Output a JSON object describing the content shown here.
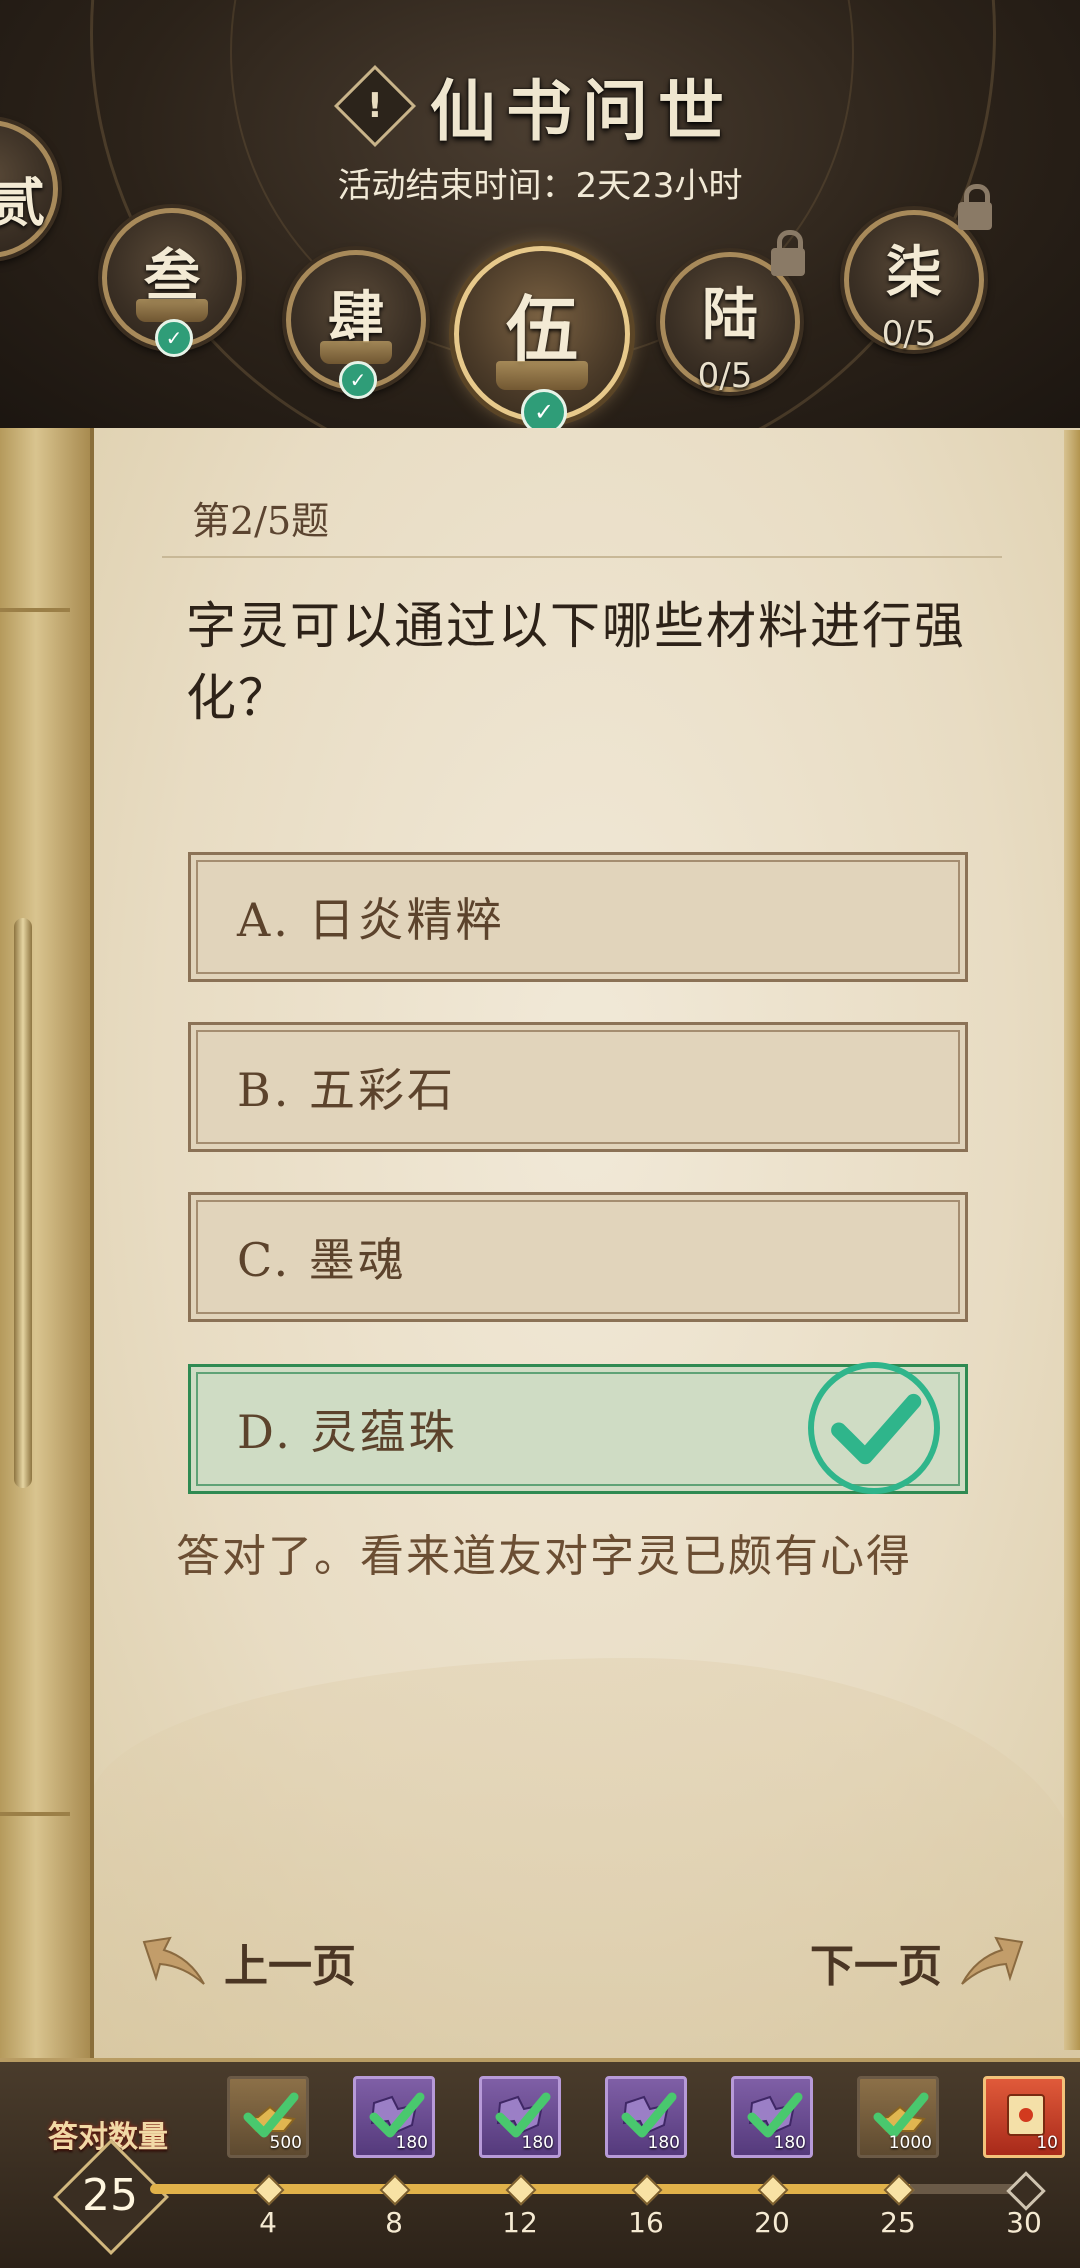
{
  "header": {
    "title": "仙书问世",
    "info_icon": "exclamation-icon",
    "subtitle": "活动结束时间：2天23小时"
  },
  "chapters": [
    {
      "label": "贰",
      "status": "completed"
    },
    {
      "label": "叁",
      "status": "completed"
    },
    {
      "label": "肆",
      "status": "completed"
    },
    {
      "label": "伍",
      "status": "active-completed"
    },
    {
      "label": "陆",
      "status": "locked",
      "progress": "0/5"
    },
    {
      "label": "柒",
      "status": "locked",
      "progress": "0/5"
    }
  ],
  "quiz": {
    "number": "第2/5题",
    "question": "字灵可以通过以下哪些材料进行强化？",
    "options": [
      {
        "text": "A. 日炎精粹",
        "state": "normal"
      },
      {
        "text": "B. 五彩石",
        "state": "normal"
      },
      {
        "text": "C. 墨魂",
        "state": "normal"
      },
      {
        "text": "D. 灵蕴珠",
        "state": "correct"
      }
    ],
    "feedback": "答对了。看来道友对字灵已颇有心得"
  },
  "nav": {
    "prev": "上一页",
    "next": "下一页"
  },
  "progress_bar": {
    "label": "答对数量",
    "count": "25",
    "milestones": [
      {
        "tick": "4",
        "reward": "500",
        "type": "gold",
        "claimed": true
      },
      {
        "tick": "8",
        "reward": "180",
        "type": "purple",
        "claimed": true
      },
      {
        "tick": "12",
        "reward": "180",
        "type": "purple",
        "claimed": true
      },
      {
        "tick": "16",
        "reward": "180",
        "type": "purple",
        "claimed": true
      },
      {
        "tick": "20",
        "reward": "180",
        "type": "purple",
        "claimed": true
      },
      {
        "tick": "25",
        "reward": "1000",
        "type": "gold",
        "claimed": true
      },
      {
        "tick": "30",
        "reward": "10",
        "type": "red",
        "claimed": false
      }
    ]
  },
  "colors": {
    "accent_gold": "#e1b24a",
    "correct_green": "#2fb58b",
    "paper": "#efe6d3"
  }
}
